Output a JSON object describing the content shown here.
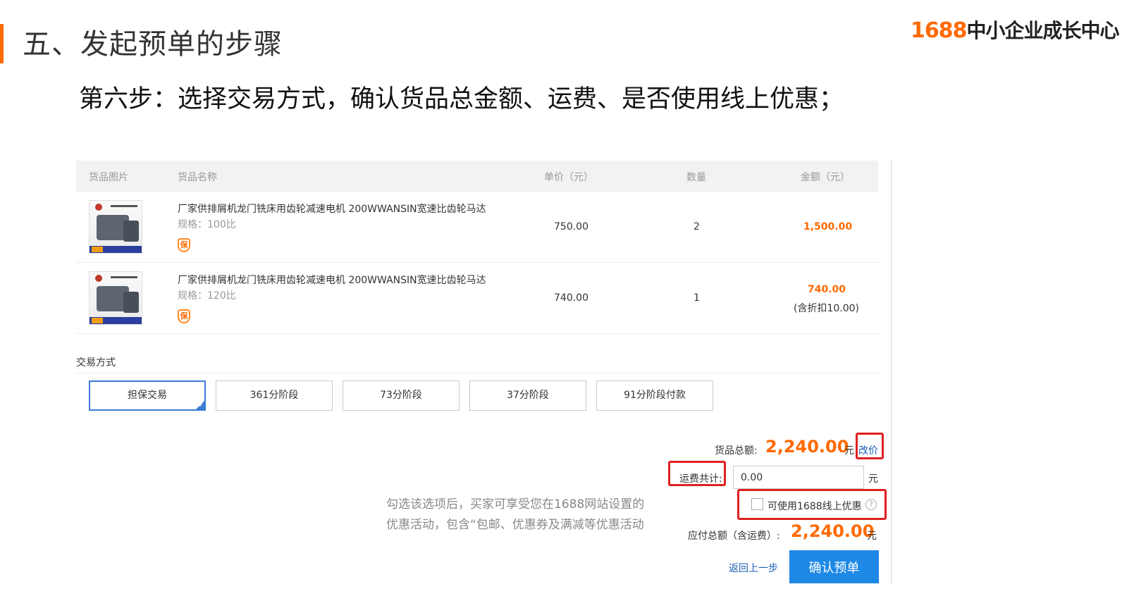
{
  "header": {
    "title": "五、发起预单的步骤",
    "brand_num": "1688",
    "brand_text": "中小企业成长中心",
    "step": "第六步：选择交易方式，确认货品总金额、运费、是否使用线上优惠；"
  },
  "table": {
    "columns": [
      "货品图片",
      "货品名称",
      "单价（元）",
      "数量",
      "金额（元）"
    ],
    "rows": [
      {
        "name": "厂家供排屑机龙门铣床用齿轮减速电机 200WWANSIN宽速比齿轮马达",
        "spec": "规格：100比",
        "badge": "保",
        "price": "750.00",
        "qty": "2",
        "amount": "1,500.00",
        "discount": ""
      },
      {
        "name": "厂家供排屑机龙门铣床用齿轮减速电机 200WWANSIN宽速比齿轮马达",
        "spec": "规格：120比",
        "badge": "保",
        "price": "740.00",
        "qty": "1",
        "amount": "740.00",
        "discount": "(含折扣10.00)"
      }
    ]
  },
  "trade": {
    "label": "交易方式",
    "options": [
      "担保交易",
      "361分阶段",
      "73分阶段",
      "37分阶段",
      "91分阶段付款"
    ],
    "selected": 0
  },
  "summary": {
    "goods_total_label": "货品总额:",
    "goods_total": "2,240.00",
    "unit": "元",
    "edit_price": "改价",
    "freight_label": "运费共计:",
    "freight_value": "0.00",
    "coupon_label": "可使用1688线上优惠",
    "help": "?",
    "tip_line1": "勾选该选项后，买家可享受您在1688网站设置的",
    "tip_line2": "优惠活动，包含“包邮、优惠券及满减等优惠活动",
    "payable_label": "应付总额（含运费）:",
    "payable": "2,240.00",
    "back": "返回上一步",
    "confirm": "确认预单"
  },
  "colors": {
    "accent": "#ff6a00",
    "link": "#1a5fb4",
    "primary_button": "#1e88e5",
    "highlight_box": "#e02020"
  }
}
